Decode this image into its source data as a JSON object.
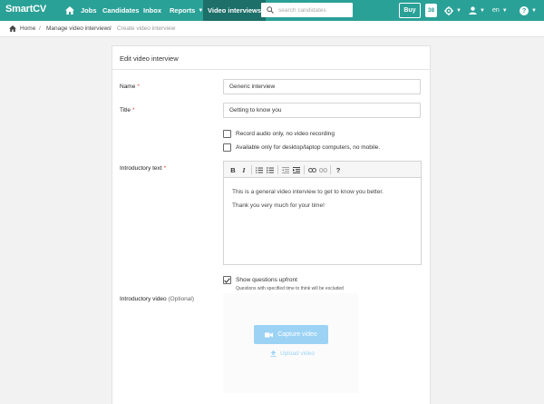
{
  "navbar": {
    "brand": "SmartCV",
    "items": [
      {
        "label": "Jobs"
      },
      {
        "label": "Candidates"
      },
      {
        "label": "Inbox"
      },
      {
        "label": "Reports"
      },
      {
        "label": "Video interviews"
      }
    ],
    "search_placeholder": "search candidates",
    "buy_label": "Buy",
    "badge_count": "38",
    "language": "en",
    "help_label": "?",
    "colors": {
      "bar": "#2aa197",
      "active": "#1d6f69"
    }
  },
  "breadcrumb": {
    "home": "Home",
    "separator": "/",
    "manage": "Manage video interviews",
    "current": "Create video interview"
  },
  "form": {
    "title": "Edit video interview",
    "name_label": "Name",
    "name_value": "Generic interview",
    "title_label": "Title",
    "title_value": "Getting to know you",
    "required_mark": "*",
    "audio_only_label": "Record audio only, no video recording",
    "desktop_only_label": "Available only for desktop/laptop computers, no mobile.",
    "intro_text_label": "Introductory text",
    "editor": {
      "toolbar": [
        "bold-icon",
        "italic-icon",
        "ordered-list-icon",
        "bullet-list-icon",
        "outdent-icon",
        "indent-icon",
        "link-icon",
        "unlink-icon",
        "help-icon"
      ],
      "bold": "B",
      "italic": "I",
      "help": "?",
      "paragraphs": [
        "This is a general video interview to get to know you better.",
        "Thank you very much for your time!"
      ]
    },
    "show_questions_label": "Show questions upfront",
    "show_questions_checked": true,
    "show_questions_note": "Questions with specified time to think will be excluded",
    "intro_video_label": "Introductory video",
    "intro_video_optional": "(Optional)",
    "capture_label": "Capture video",
    "upload_label": "Upload video",
    "colors": {
      "capture": "#9cd3f5",
      "required": "#e74c3c"
    }
  }
}
